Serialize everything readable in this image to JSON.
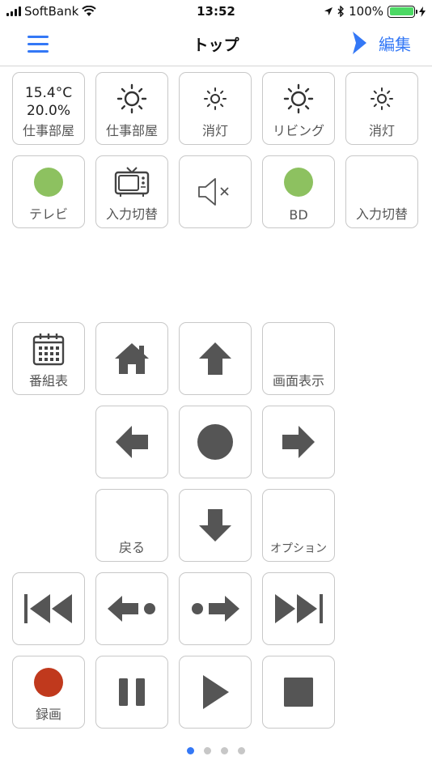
{
  "status_bar": {
    "carrier": "SoftBank",
    "time": "13:52",
    "battery": "100%"
  },
  "nav": {
    "title": "トップ",
    "edit_label": "編集"
  },
  "env": {
    "temperature": "15.4°C",
    "humidity": "20.0%",
    "room": "仕事部屋"
  },
  "row1": {
    "light_work": "仕事部屋",
    "light_off_1": "消灯",
    "light_living": "リビング",
    "light_off_2": "消灯"
  },
  "row2": {
    "tv": "テレビ",
    "input_switch_1": "入力切替",
    "bd": "BD",
    "input_switch_2": "入力切替"
  },
  "remote": {
    "program_guide": "番組表",
    "screen_display": "画面表示",
    "back": "戻る",
    "option": "オプション",
    "record": "録画"
  },
  "colors": {
    "accent": "#3478f6",
    "power_on": "#8dc160",
    "record": "#c0391d",
    "icon": "#555555"
  },
  "pager": {
    "pages": 4,
    "current": 1
  }
}
